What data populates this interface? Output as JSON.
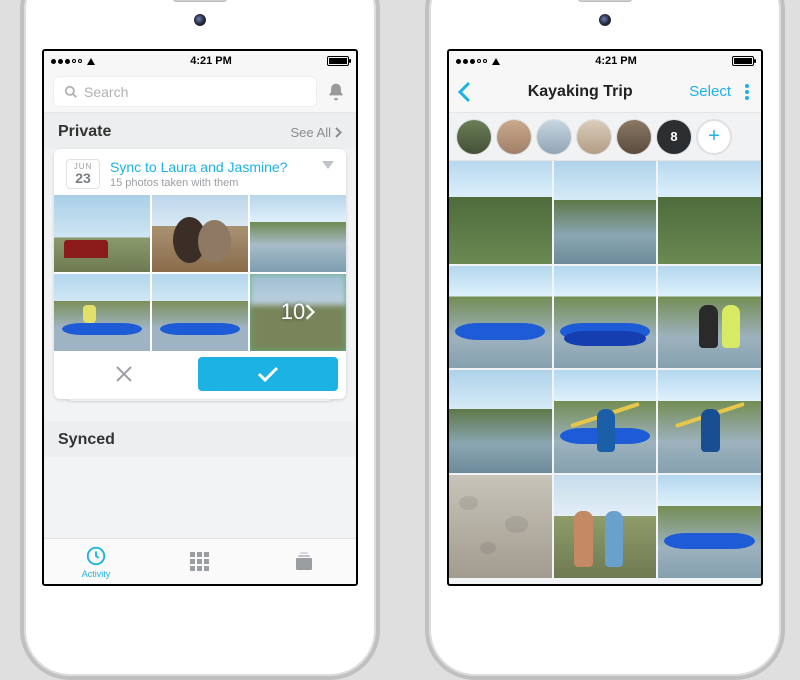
{
  "status": {
    "time": "4:21 PM"
  },
  "left": {
    "search_placeholder": "Search",
    "section_private": "Private",
    "see_all": "See All",
    "card": {
      "month": "JUN",
      "day": "23",
      "sync_prefix": "Sync to ",
      "sync_names": "Laura and Jasmine",
      "sync_suffix": "?",
      "subtitle": "15 photos taken with them",
      "more_count": "10"
    },
    "section_synced": "Synced",
    "tab_activity": "Activity"
  },
  "right": {
    "title": "Kayaking Trip",
    "select": "Select",
    "overflow_count": "8",
    "add_glyph": "+"
  }
}
